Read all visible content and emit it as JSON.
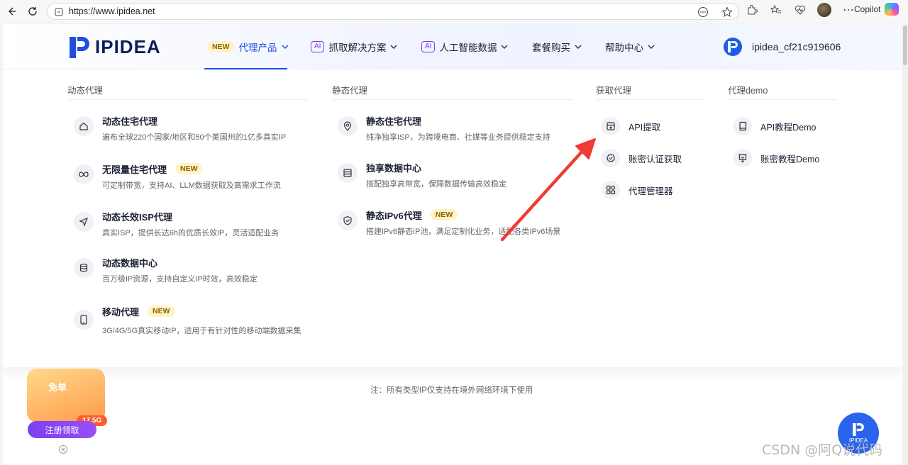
{
  "browser": {
    "url": "https://www.ipidea.net",
    "copilot_label": "Copilot"
  },
  "header": {
    "logo_text": "IPIDEA",
    "nav": [
      {
        "badge": "NEW",
        "label": "代理产品"
      },
      {
        "badge": "AI",
        "label": "抓取解决方案"
      },
      {
        "badge": "AI",
        "label": "人工智能数据"
      },
      {
        "label": "套餐购买"
      },
      {
        "label": "帮助中心"
      }
    ],
    "user_name": "ipidea_cf21c919606"
  },
  "dropdown": {
    "dynamic": {
      "title": "动态代理",
      "items": [
        {
          "title": "动态住宅代理",
          "desc": "遍布全球220个国家/地区和50个美国州的1亿多真实IP",
          "icon": "home-icon"
        },
        {
          "title": "无限量住宅代理",
          "badge": "NEW",
          "desc": "可定制带宽，支持AI、LLM数据获取及高需求工作流",
          "icon": "infinity-icon"
        },
        {
          "title": "动态长效ISP代理",
          "desc": "真实ISP，提供长达6h的优质长效IP，灵活适配业务",
          "icon": "send-icon"
        },
        {
          "title": "动态数据中心",
          "desc": "百万级IP资源，支持自定义IP时效，高效稳定",
          "icon": "database-icon"
        },
        {
          "title": "移动代理",
          "badge": "NEW",
          "desc": "3G/4G/5G真实移动IP，适用于有针对性的移动端数据采集",
          "icon": "phone-icon"
        }
      ]
    },
    "static": {
      "title": "静态代理",
      "items": [
        {
          "title": "静态住宅代理",
          "desc": "纯净独享ISP，为跨境电商、社媒等业务提供稳定支持",
          "icon": "location-icon"
        },
        {
          "title": "独享数据中心",
          "desc": "搭配独享高带宽，保障数据传输高效稳定",
          "icon": "server-icon"
        },
        {
          "title": "静态IPv6代理",
          "badge": "NEW",
          "desc": "搭建IPv6静态IP池，满足定制化业务，适配各类IPv6场景",
          "icon": "shield-icon"
        }
      ]
    },
    "get_proxy": {
      "title": "获取代理",
      "items": [
        {
          "label": "API提取",
          "icon": "api-icon"
        },
        {
          "label": "账密认证获取",
          "icon": "badge-check-icon"
        },
        {
          "label": "代理管理器",
          "icon": "grid-icon"
        }
      ]
    },
    "demo": {
      "title": "代理demo",
      "items": [
        {
          "label": "API教程Demo",
          "icon": "book-icon"
        },
        {
          "label": "账密教程Demo",
          "icon": "presentation-icon"
        }
      ]
    }
  },
  "note": "注：所有类型IP仅支持在境外网络环境下使用",
  "promo": {
    "tag": "免单",
    "size": "17.5G",
    "button": "注册领取"
  },
  "float_logo_text": "IPIDEA",
  "watermark": "CSDN @阿Q说代码",
  "colors": {
    "primary": "#1f4fe0",
    "ai_purple": "#7a3cf3",
    "arrow_red": "#ef3b32"
  }
}
